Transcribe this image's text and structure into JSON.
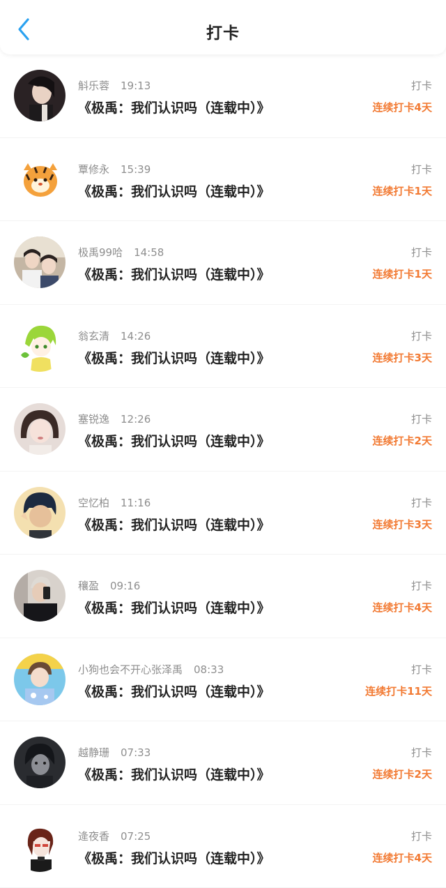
{
  "header": {
    "title": "打卡"
  },
  "colors": {
    "accent": "#2aa1f0",
    "streak": "#f27a33"
  },
  "items": [
    {
      "user": "斛乐蓉",
      "time": "19:13",
      "book": "《极禹：我们认识吗（连载中）》",
      "action": "打卡",
      "streak": "连续打卡4天"
    },
    {
      "user": "覃修永",
      "time": "15:39",
      "book": "《极禹：我们认识吗（连载中）》",
      "action": "打卡",
      "streak": "连续打卡1天"
    },
    {
      "user": "极禹99哈",
      "time": "14:58",
      "book": "《极禹：我们认识吗（连载中）》",
      "action": "打卡",
      "streak": "连续打卡1天"
    },
    {
      "user": "翁玄清",
      "time": "14:26",
      "book": "《极禹：我们认识吗（连载中）》",
      "action": "打卡",
      "streak": "连续打卡3天"
    },
    {
      "user": "塞锐逸",
      "time": "12:26",
      "book": "《极禹：我们认识吗（连载中）》",
      "action": "打卡",
      "streak": "连续打卡2天"
    },
    {
      "user": "空忆柏",
      "time": "11:16",
      "book": "《极禹：我们认识吗（连载中）》",
      "action": "打卡",
      "streak": "连续打卡3天"
    },
    {
      "user": "穰盈",
      "time": "09:16",
      "book": "《极禹：我们认识吗（连载中）》",
      "action": "打卡",
      "streak": "连续打卡4天"
    },
    {
      "user": "小狗也会不开心张泽禹",
      "time": "08:33",
      "book": "《极禹：我们认识吗（连载中）》",
      "action": "打卡",
      "streak": "连续打卡11天"
    },
    {
      "user": "越静珊",
      "time": "07:33",
      "book": "《极禹：我们认识吗（连载中）》",
      "action": "打卡",
      "streak": "连续打卡2天"
    },
    {
      "user": "逄夜香",
      "time": "07:25",
      "book": "《极禹：我们认识吗（连载中）》",
      "action": "打卡",
      "streak": "连续打卡4天"
    }
  ]
}
